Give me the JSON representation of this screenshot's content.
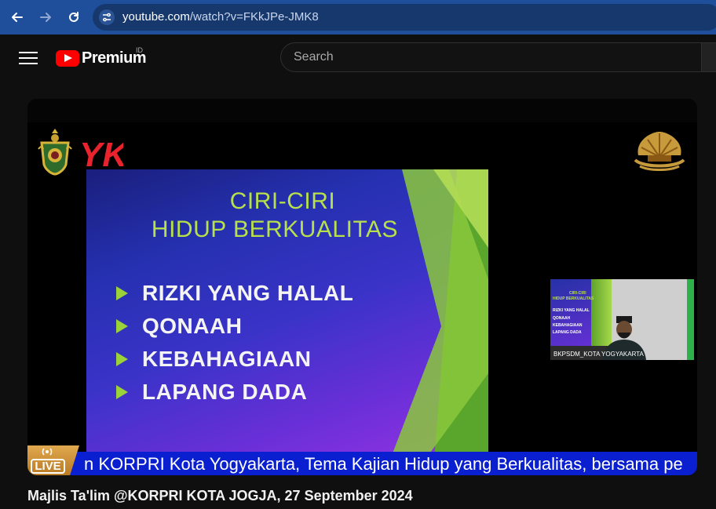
{
  "browser": {
    "url_domain": "youtube.com",
    "url_path": "/watch?v=FKkJPe-JMK8",
    "back_icon": "arrow-left-icon",
    "forward_icon": "arrow-right-icon",
    "reload_icon": "reload-icon",
    "site_info_icon": "tune-icon"
  },
  "masthead": {
    "logo_text": "Premium",
    "country_code": "ID",
    "search_placeholder": "Search"
  },
  "player": {
    "slide": {
      "title_line1": "CIRI-CIRI",
      "title_line2": "HIDUP BERKUALITAS",
      "bullets": [
        "RIZKI YANG HALAL",
        "QONAAH",
        "KEBAHAGIAAN",
        "LAPANG DADA"
      ]
    },
    "pip": {
      "caption": "BKPSDM_KOTA YOGYAKARTA",
      "mini_lines": [
        "CIRI-CIRI",
        "HIDUP BERKUALITAS",
        "RIZKI YANG HALAL",
        "QONAAH",
        "KEBAHAGIAAN",
        "LAPANG DADA"
      ]
    },
    "ticker_text": "n KORPRI Kota Yogyakarta, Tema Kajian Hidup yang Berkualitas, bersama pe",
    "live_label": "LIVE",
    "yk_logo_text": "YK"
  },
  "video": {
    "title": "Majlis Ta'lim @KORPRI KOTA JOGJA, 27 September 2024"
  },
  "colors": {
    "browser_bar": "#1f4f9a",
    "youtube_red": "#ff0000",
    "slide_title": "#b7e04a",
    "ticker_bg": "#0a1fcf",
    "live_badge": "#d9a049"
  }
}
